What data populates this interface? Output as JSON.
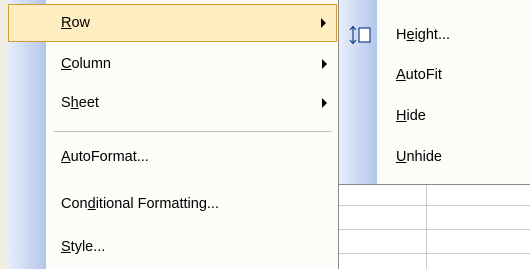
{
  "menu": {
    "items": [
      {
        "pre": "",
        "u": "R",
        "post": "ow",
        "has_submenu": true,
        "active": true
      },
      {
        "pre": "",
        "u": "C",
        "post": "olumn",
        "has_submenu": true
      },
      {
        "pre": "S",
        "u": "h",
        "post": "eet",
        "has_submenu": true
      },
      {
        "pre": "",
        "u": "A",
        "post": "utoFormat...",
        "has_submenu": false
      },
      {
        "pre": "Con",
        "u": "d",
        "post": "itional Formatting...",
        "has_submenu": false
      },
      {
        "pre": "",
        "u": "S",
        "post": "tyle...",
        "has_submenu": false
      }
    ]
  },
  "submenu": {
    "items": [
      {
        "pre": "H",
        "u": "e",
        "post": "ight...",
        "icon": "row-height-icon"
      },
      {
        "pre": "",
        "u": "A",
        "post": "utoFit"
      },
      {
        "pre": "",
        "u": "H",
        "post": "ide"
      },
      {
        "pre": "",
        "u": "U",
        "post": "nhide"
      }
    ]
  },
  "colors": {
    "highlight_bg": "#ffeec2",
    "highlight_border": "#d69a37",
    "gutter_light": "#e8eefb",
    "gutter_dark": "#b3c6ea"
  }
}
